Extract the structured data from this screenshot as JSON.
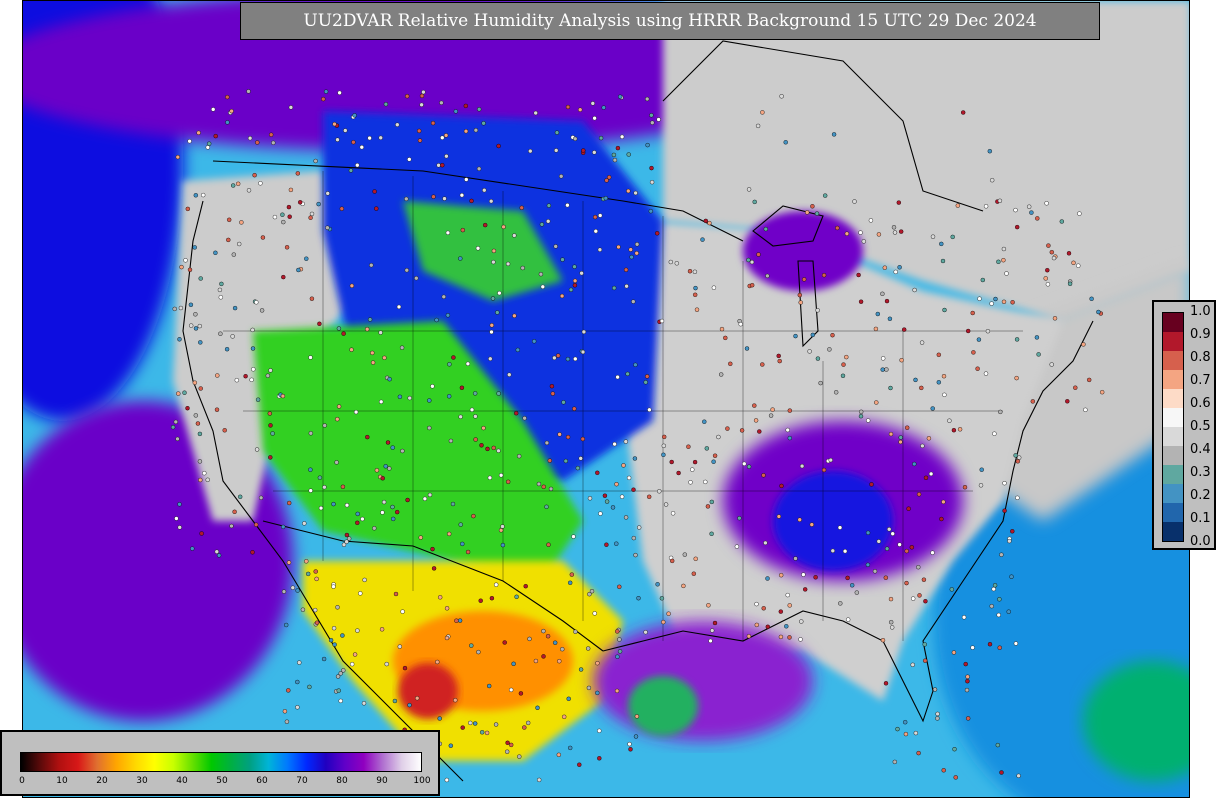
{
  "title": "UU2DVAR Relative Humidity Analysis using HRRR Background 15 UTC 29 Dec 2024",
  "rh_colorbar": {
    "ticks": [
      "0",
      "10",
      "20",
      "30",
      "40",
      "50",
      "60",
      "70",
      "80",
      "90",
      "100"
    ],
    "colors": [
      "#000000",
      "#5a0a0a",
      "#b01010",
      "#d81818",
      "#e07030",
      "#ffa500",
      "#ffd700",
      "#ffff00",
      "#c8ff00",
      "#66e000",
      "#00c800",
      "#00b040",
      "#00a080",
      "#00b4d8",
      "#0078ff",
      "#0028ff",
      "#2000c0",
      "#6000c8",
      "#9000c0",
      "#b070d0",
      "#e0d0e8",
      "#ffffff"
    ]
  },
  "obs_colorbar": {
    "ticks": [
      "0.0",
      "0.1",
      "0.2",
      "0.3",
      "0.4",
      "0.5",
      "0.6",
      "0.7",
      "0.8",
      "0.9",
      "1.0"
    ],
    "colors": [
      "#08306b",
      "#2166ac",
      "#4393c3",
      "#5fa8a0",
      "#b3b3b3",
      "#d9d9d9",
      "#f7f7f7",
      "#fddbc7",
      "#f4a582",
      "#d6604d",
      "#b2182b",
      "#67001f"
    ]
  },
  "map": {
    "ocean_color": "#3cb8e8",
    "dry_land_color": "#cccccc",
    "moist_color": "#6a00c8",
    "sat_color": "#1010e0"
  }
}
